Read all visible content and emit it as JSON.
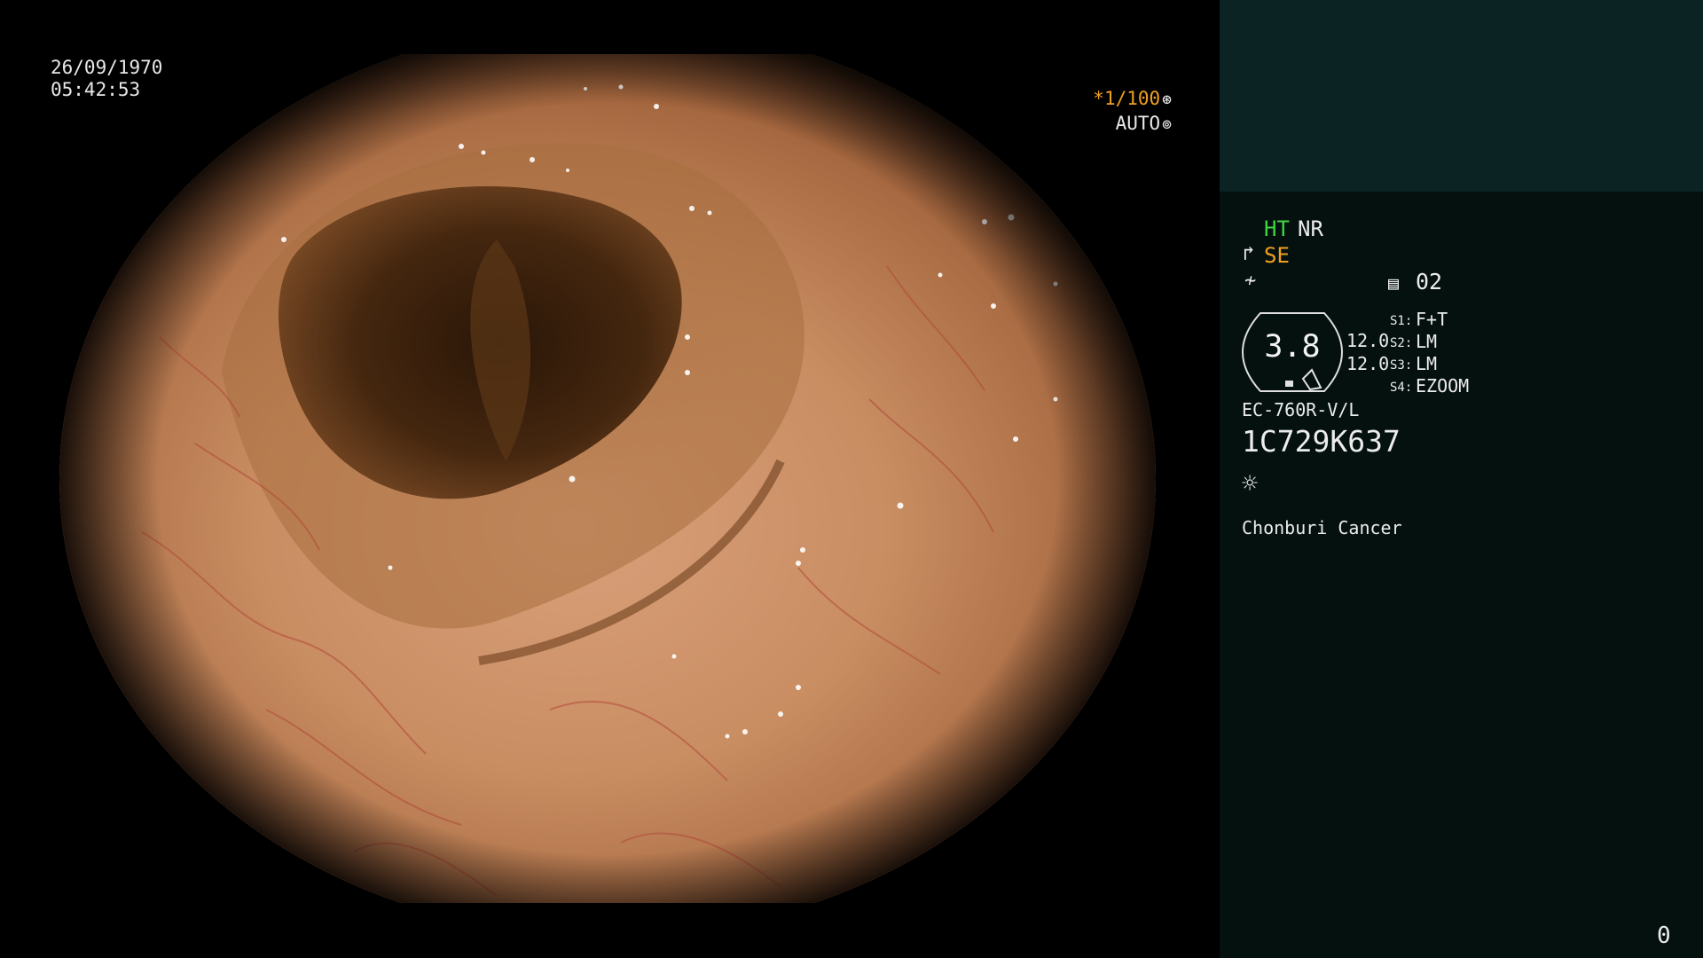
{
  "scope_overlay": {
    "date": "26/09/1970",
    "time": "05:42:53",
    "shutter_prefix": "*",
    "shutter": "1/100",
    "shutter_icon": "shutter-icon",
    "exposure_mode": "AUTO",
    "exposure_icon": "iris-icon"
  },
  "info_panel": {
    "ht_label": "HT",
    "nr_label": "NR",
    "se_icon": "structure-enhancement-icon",
    "se_label": "SE",
    "enhancement_icon": "enhancement-curve-icon",
    "page_icon": "page-list-icon",
    "page_number": "02",
    "zoom_value": "3.8",
    "value_1": "12.0",
    "value_2": "12.0",
    "switches": [
      {
        "label": "S1:",
        "value": "F+T"
      },
      {
        "label": "S2:",
        "value": "LM"
      },
      {
        "label": "S3:",
        "value": "LM"
      },
      {
        "label": "S4:",
        "value": "EZOOM"
      }
    ],
    "scope_model": "EC-760R-V/L",
    "serial_number": "1C729K637",
    "light_icon": "light-source-icon",
    "institution": "Chonburi Cancer",
    "frame_counter": "0"
  },
  "colors": {
    "panel_background": "#04110f",
    "panel_top_background": "#0c2324",
    "ht_color": "#3fd640",
    "accent_orange": "#f0a020"
  }
}
